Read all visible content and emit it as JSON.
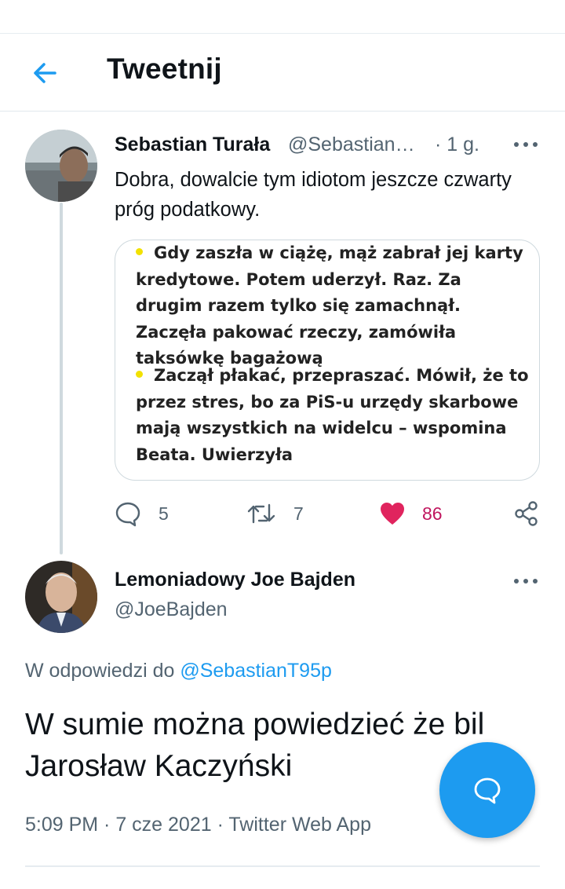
{
  "header": {
    "title": "Tweetnij"
  },
  "parent_tweet": {
    "author_name": "Sebastian Turała",
    "handle": "@Sebastian…",
    "time": "· 1 g.",
    "text": "Dobra, dowalcie tym idiotom jeszcze czwarty próg podatkowy.",
    "image_card": {
      "paragraph1": "Gdy zaszła w ciążę, mąż zabrał jej karty kredytowe. Potem uderzył. Raz. Za drugim razem tylko się zamachnął. Zaczęła pakować rzeczy, zamówiła taksówkę bagażową",
      "paragraph2": "Zaczął płakać, przepraszać. Mówił, że to przez stres, bo za PiS-u urzędy skarbowe mają wszystkich na widelcu – wspomina Beata. Uwierzyła"
    },
    "stats": {
      "replies": "5",
      "retweets": "7",
      "likes": "86"
    }
  },
  "main_tweet": {
    "author_name": "Lemoniadowy Joe Bajden",
    "handle": "@JoeBajden",
    "reply_prefix": "W odpowiedzi do ",
    "reply_handle": "@SebastianT95p",
    "text": "W sumie można powiedzieć że bil Jarosław Kaczyński",
    "meta": "5:09 PM · 7 cze 2021 · Twitter Web App"
  },
  "colors": {
    "accent": "#1d9bf0",
    "like": "#e0245e",
    "muted": "#536471"
  },
  "icons": [
    "back-arrow-icon",
    "more-icon",
    "reply-icon",
    "retweet-icon",
    "heart-icon",
    "share-icon",
    "compose-reply-icon"
  ]
}
